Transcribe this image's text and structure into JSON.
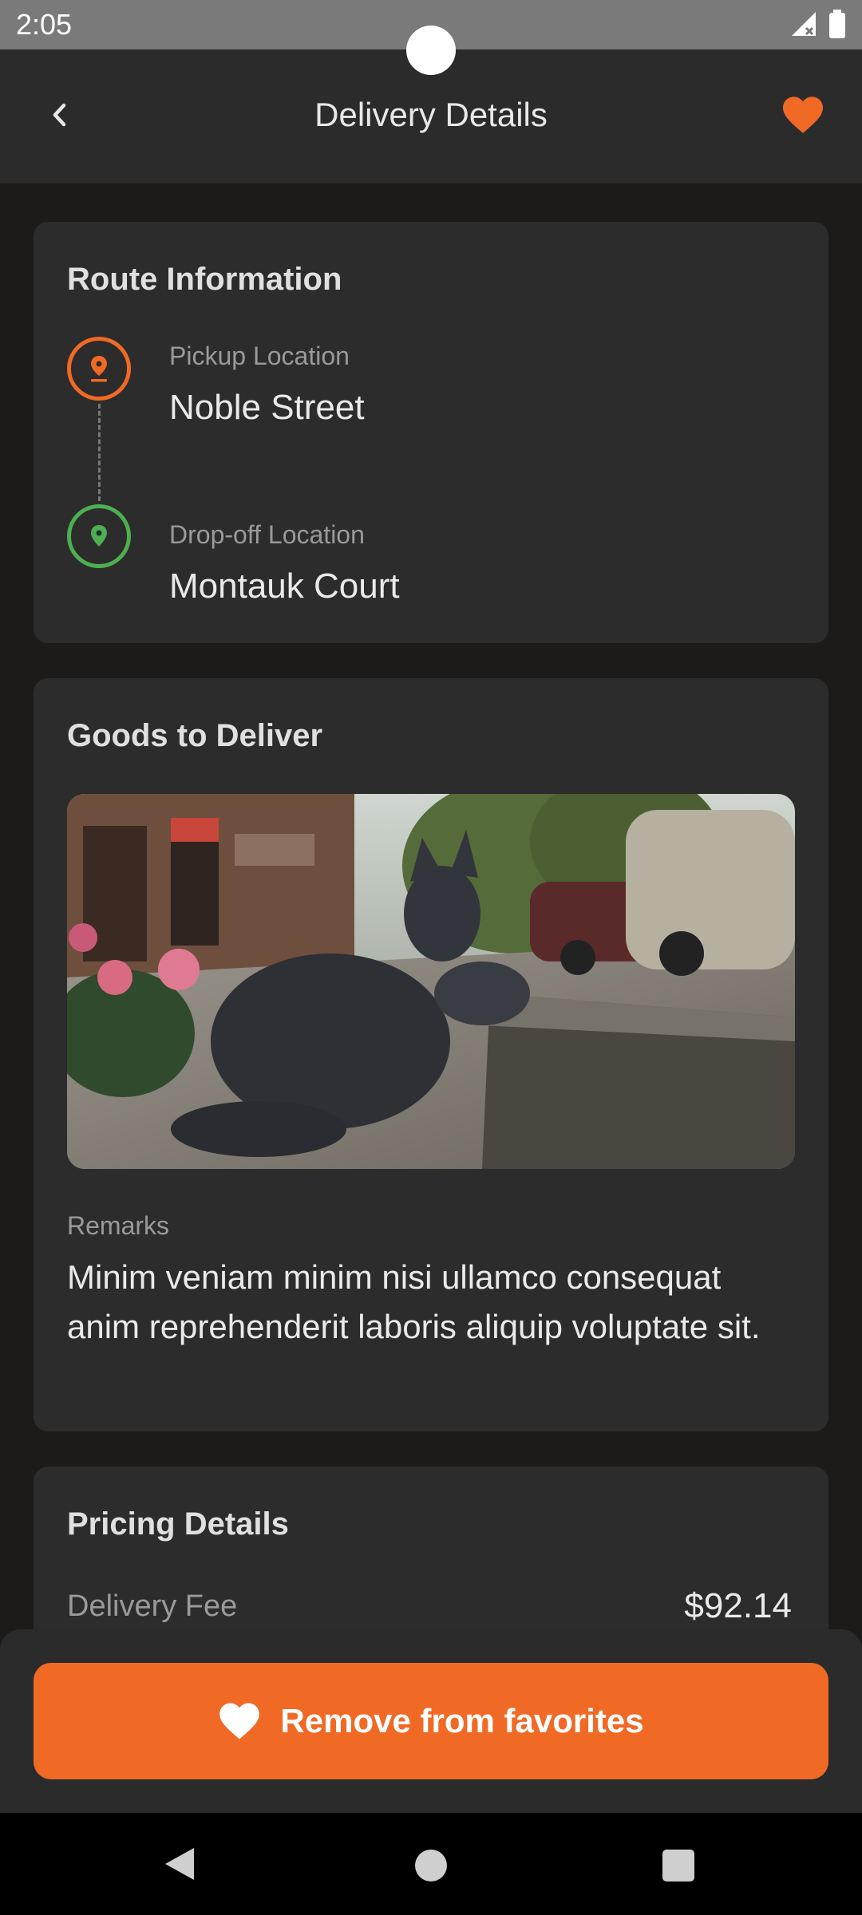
{
  "status_bar": {
    "time": "2:05"
  },
  "app_bar": {
    "title": "Delivery Details"
  },
  "route": {
    "title": "Route Information",
    "pickup_label": "Pickup Location",
    "pickup_value": "Noble Street",
    "dropoff_label": "Drop-off Location",
    "dropoff_value": "Montauk Court"
  },
  "goods": {
    "title": "Goods to Deliver",
    "remarks_label": "Remarks",
    "remarks_text": "Minim veniam minim nisi ullamco consequat anim reprehenderit laboris aliquip voluptate sit."
  },
  "pricing": {
    "title": "Pricing Details",
    "fee_label": "Delivery Fee",
    "fee_value": "$92.14"
  },
  "action": {
    "remove_label": "Remove from favorites"
  },
  "colors": {
    "accent": "#f06a25",
    "dropoff": "#4caf50",
    "background": "#1c1b1a",
    "card": "#2c2c2c"
  },
  "icons": [
    "back-arrow-icon",
    "heart-icon",
    "pickup-pin-icon",
    "dropoff-pin-icon",
    "signal-icon",
    "battery-icon"
  ]
}
